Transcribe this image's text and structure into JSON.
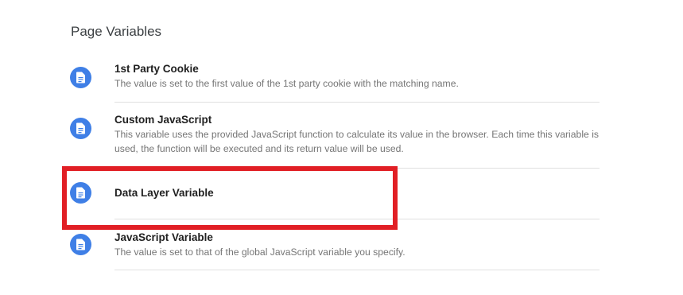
{
  "section": {
    "title": "Page Variables"
  },
  "variables": [
    {
      "name": "1st Party Cookie",
      "description": "The value is set to the first value of the 1st party cookie with the matching name.",
      "icon": "document-icon"
    },
    {
      "name": "Custom JavaScript",
      "description": "This variable uses the provided JavaScript function to calculate its value in the browser. Each time this variable is used, the function will be executed and its return value will be used.",
      "icon": "document-icon"
    },
    {
      "name": "Data Layer Variable",
      "description": "",
      "icon": "document-icon"
    },
    {
      "name": "JavaScript Variable",
      "description": "The value is set to that of the global JavaScript variable you specify.",
      "icon": "document-icon"
    }
  ],
  "highlight": {
    "target": "Data Layer Variable",
    "color": "#e11f25"
  },
  "colors": {
    "icon_background": "#3f7fe6",
    "title_text": "#212121",
    "description_text": "#757575",
    "divider": "#e0e0e0"
  }
}
